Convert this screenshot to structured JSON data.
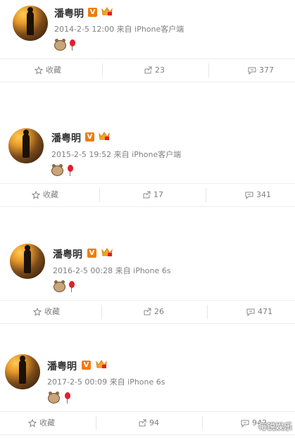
{
  "posts": [
    {
      "name": "潘粤明",
      "time": "2014-2-5 12:00",
      "from": "来自",
      "device": "iPhone客户端",
      "collect": "收藏",
      "reposts": "23",
      "comments": "377"
    },
    {
      "name": "潘粤明",
      "time": "2015-2-5 19:52",
      "from": "来自",
      "device": "iPhone客户端",
      "collect": "收藏",
      "reposts": "17",
      "comments": "341"
    },
    {
      "name": "潘粤明",
      "time": "2016-2-5 00:28",
      "from": "来自",
      "device": "iPhone 6s",
      "collect": "收藏",
      "reposts": "26",
      "comments": "471"
    },
    {
      "name": "潘粤明",
      "time": "2017-2-5 00:09",
      "from": "来自",
      "device": "iPhone 6s",
      "collect": "收藏",
      "reposts": "94",
      "comments": "942"
    }
  ],
  "watermark": "每锐娱乐",
  "colors": {
    "vip_orange": "#f07c0f",
    "meta_gray": "#808080",
    "balloon_red": "#e0202a"
  },
  "icons": [
    "verified-v-icon",
    "vip-crown-icon",
    "cow-emoji",
    "balloon-emoji",
    "star-icon",
    "repost-icon",
    "comment-icon"
  ]
}
